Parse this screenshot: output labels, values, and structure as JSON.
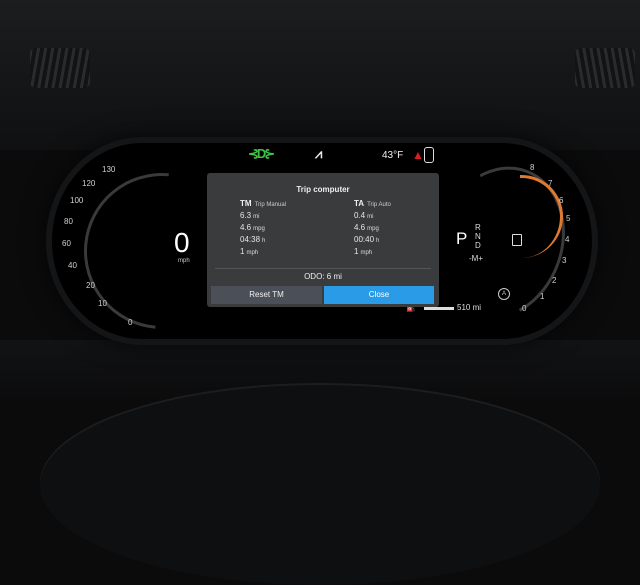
{
  "indicators": {
    "beam_icon": "auto-high-beam-icon",
    "lane_icon": "lane-assist-icon",
    "outside_temp": "43°F",
    "seatbelt_icon": "seatbelt-warning-icon",
    "car_icon": "car-door-icon",
    "beam_glyph": "⊰D⊱",
    "lane_glyph": "⩘",
    "belt_glyph": "▲",
    "colors": {
      "beam": "#3ec24a",
      "warning": "#d62020",
      "tach_redline": "#e07a30",
      "accent_button": "#2a9be6"
    }
  },
  "speedometer": {
    "ticks": [
      "0",
      "10",
      "20",
      "40",
      "60",
      "80",
      "100",
      "120",
      "130"
    ],
    "speed": "0",
    "unit": "mph"
  },
  "tachometer": {
    "ticks": [
      "8",
      "7",
      "6",
      "5",
      "4",
      "3",
      "2",
      "1",
      "0"
    ]
  },
  "gear": {
    "current": "P",
    "options": [
      "R",
      "N",
      "D"
    ],
    "mode": "-M+"
  },
  "range": {
    "value": "510 mi"
  },
  "trip_computer": {
    "title": "Trip computer",
    "tm": {
      "code": "TM",
      "label": "Trip Manual",
      "distance": "6.3",
      "distance_unit": "mi",
      "economy": "4.6",
      "economy_unit": "mpg",
      "time": "04:38",
      "time_unit": "h",
      "speed": "1",
      "speed_unit": "mph"
    },
    "ta": {
      "code": "TA",
      "label": "Trip Auto",
      "distance": "0.4",
      "distance_unit": "mi",
      "economy": "4.6",
      "economy_unit": "mpg",
      "time": "00:40",
      "time_unit": "h",
      "speed": "1",
      "speed_unit": "mph"
    },
    "odo_label": "ODO:",
    "odo_value": "6",
    "odo_unit": "mi",
    "reset_label": "Reset TM",
    "close_label": "Close"
  }
}
